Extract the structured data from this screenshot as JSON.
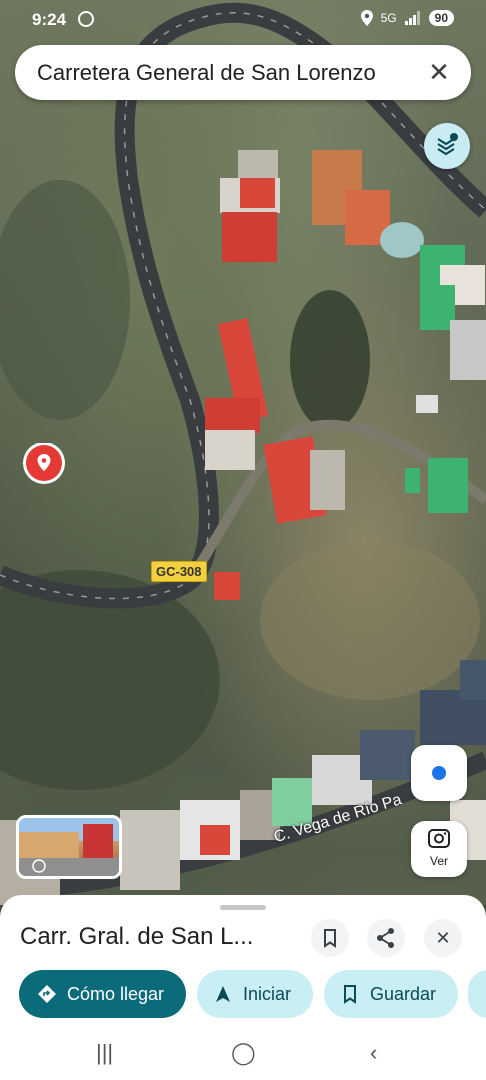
{
  "status_bar": {
    "time": "9:24",
    "network": "5G",
    "battery": "90"
  },
  "search": {
    "query": "Carretera General de San Lorenzo"
  },
  "map": {
    "road_label": "GC-308",
    "street_label": "C. Vega de Río Pa"
  },
  "controls": {
    "lens_label": "Ver"
  },
  "sheet": {
    "place_title": "Carr. Gral. de San L...",
    "actions": [
      {
        "label": "Cómo llegar",
        "icon": "directions-icon"
      },
      {
        "label": "Iniciar",
        "icon": "navigation-arrow-icon"
      },
      {
        "label": "Guardar",
        "icon": "bookmark-icon"
      }
    ]
  },
  "colors": {
    "primary_chip": "#0b6b7a",
    "secondary_chip": "#c9eef3",
    "pin": "#e53935",
    "road_shield": "#f4d03f"
  }
}
